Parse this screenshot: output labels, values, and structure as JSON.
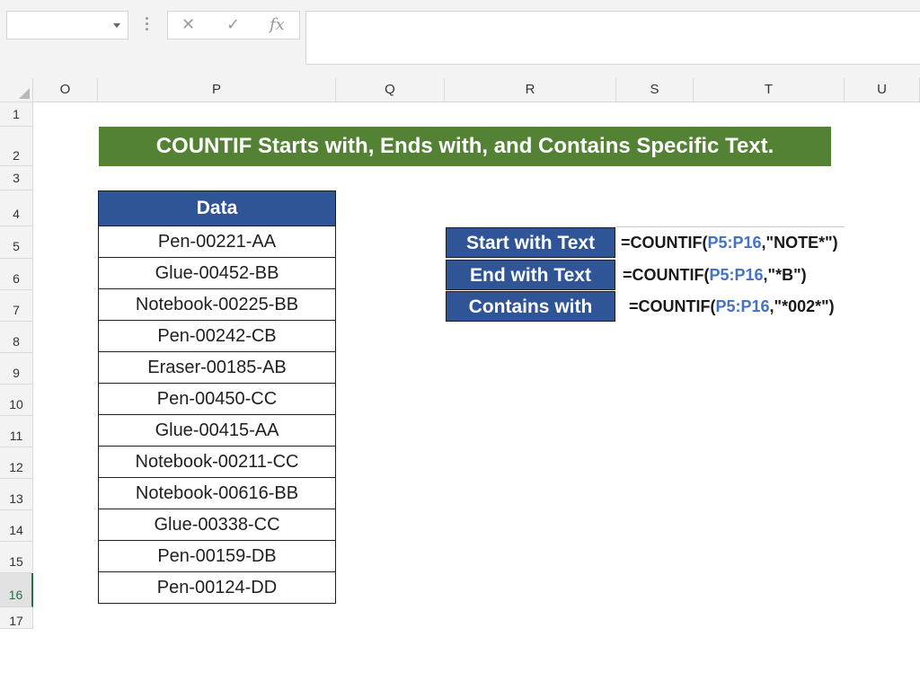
{
  "toolbar": {
    "name_box": "",
    "cancel_icon": "✕",
    "enter_icon": "✓",
    "fx_label": "fx",
    "formula_bar": ""
  },
  "columns": [
    "O",
    "P",
    "Q",
    "R",
    "S",
    "T",
    "U"
  ],
  "rows": [
    "1",
    "2",
    "3",
    "4",
    "5",
    "6",
    "7",
    "8",
    "9",
    "10",
    "11",
    "12",
    "13",
    "14",
    "15",
    "16",
    "17"
  ],
  "sheet": {
    "title": "COUNTIF Starts with, Ends with, and Contains Specific Text.",
    "data_header": "Data",
    "data": [
      "Pen-00221-AA",
      "Glue-00452-BB",
      "Notebook-00225-BB",
      "Pen-00242-CB",
      "Eraser-00185-AB",
      "Pen-00450-CC",
      "Glue-00415-AA",
      "Notebook-00211-CC",
      "Notebook-00616-BB",
      "Glue-00338-CC",
      "Pen-00159-DB",
      "Pen-00124-DD"
    ],
    "criteria": [
      {
        "label": "Start with Text",
        "formula_prefix": "=COUNTIF(",
        "range": "P5:P16",
        "formula_suffix": ",\"NOTE*\")"
      },
      {
        "label": "End with Text",
        "formula_prefix": "=COUNTIF(",
        "range": "P5:P16",
        "formula_suffix": ",\"*B\")"
      },
      {
        "label": "Contains with",
        "formula_prefix": "=COUNTIF(",
        "range": "P5:P16",
        "formula_suffix": ",\"*002*\")"
      }
    ]
  },
  "colors": {
    "title_bg": "#548235",
    "header_bg": "#2f5597",
    "reference": "#4472c4",
    "selected_row": "#217346"
  }
}
